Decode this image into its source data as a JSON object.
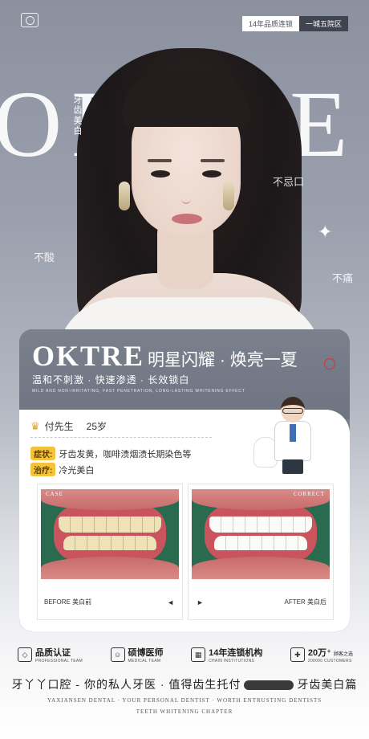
{
  "header": {
    "tag_quality": "14年品质连锁",
    "tag_branch": "一城五院区"
  },
  "hero": {
    "big_word": "OKTRE",
    "vertical_text": "牙齿美白",
    "float_1": "不忌口",
    "float_2": "不酸",
    "float_3": "不痛",
    "sparkle": "✦"
  },
  "card": {
    "title_brand": "OKTRE",
    "title_slogan": "明星闪耀 · 焕亮一夏",
    "subtitle": "温和不刺激 · 快速渗透 · 长效锁白",
    "subtitle_en": "MILD AND NON-IRRITATING, FAST PENETRATION, LONG-LASTING WHITENING EFFECT",
    "patient_name": "付先生",
    "patient_age": "25岁",
    "symptom_label": "症状:",
    "symptom_text": "牙齿发黄，咖啡渍烟渍长期染色等",
    "treatment_label": "治疗:",
    "treatment_text": "冷光美白",
    "before_tag": "CASE",
    "after_tag": "CORRECT",
    "before_label": "BEFORE 美白前",
    "after_label": "AFTER 美白后",
    "before_arrow": "◄",
    "after_arrow": "►"
  },
  "features": [
    {
      "icon": "diamond-icon",
      "glyph": "◇",
      "title": "品质认证",
      "sub": "PROFESSIONAL TEAM"
    },
    {
      "icon": "doctor-icon",
      "glyph": "☺",
      "title": "硕博医师",
      "sub": "MEDICAL TEAM"
    },
    {
      "icon": "building-icon",
      "glyph": "▦",
      "title": "14年连锁机构",
      "sub": "CHAIN INSTITUTIONS"
    },
    {
      "icon": "customer-icon",
      "glyph": "✚",
      "title": "20万⁺",
      "title_small": "顾客之选",
      "sub": "200000 CUSTOMERS"
    }
  ],
  "footer": {
    "slogan_a": "牙丫丫口腔 - 你的私人牙医 · 值得齿生托付",
    "slogan_b": "牙齿美白篇",
    "en_line1": "YAXIANSEN DENTAL · YOUR PERSONAL DENTIST · WORTH ENTRUSTING DENTISTS",
    "en_line2": "TEETH WHITENING CHAPTER"
  }
}
